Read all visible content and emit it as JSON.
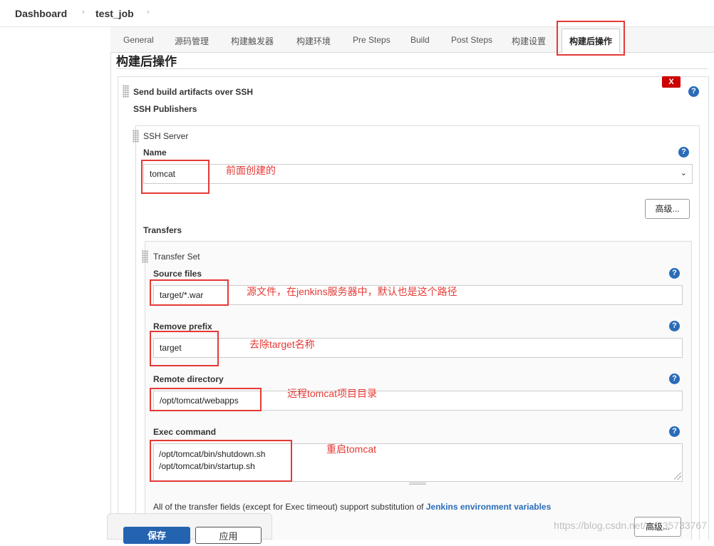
{
  "breadcrumb": {
    "dashboard": "Dashboard",
    "job": "test_job",
    "separator": "›"
  },
  "tabs": [
    "General",
    "源码管理",
    "构建触发器",
    "构建环境",
    "Pre Steps",
    "Build",
    "Post Steps",
    "构建设置",
    "构建后操作"
  ],
  "section": {
    "title": "构建后操作"
  },
  "publisher": {
    "title": "Send build artifacts over SSH",
    "close_label": "X",
    "ssh_publishers_label": "SSH Publishers",
    "ssh_server_label": "SSH Server",
    "name_label": "Name",
    "name_value": "tomcat",
    "advanced_label": "高级...",
    "transfers_label": "Transfers",
    "transfer_set_label": "Transfer Set",
    "source_files_label": "Source files",
    "source_files_value": "target/*.war",
    "remove_prefix_label": "Remove prefix",
    "remove_prefix_value": "target",
    "remote_directory_label": "Remote directory",
    "remote_directory_value": "/opt/tomcat/webapps",
    "exec_command_label": "Exec command",
    "exec_command_line1": "/opt/tomcat/bin/shutdown.sh",
    "exec_command_line2": "/opt/tomcat/bin/startup.sh",
    "note_text": "All of the transfer fields (except for Exec timeout) support substitution of ",
    "note_link": "Jenkins environment variables",
    "advanced2_label": "高级..."
  },
  "annotations": {
    "name": "前面创建的",
    "source_files": "源文件，在jenkins服务器中，默认也是这个路径",
    "remove_prefix": "去除target名称",
    "remote_directory": "远程tomcat项目目录",
    "exec_command": "重启tomcat"
  },
  "help_icon": "?",
  "footer": {
    "save_label": "保存",
    "apply_label": "应用"
  },
  "watermark": "https://blog.csdn.net/qq_35733767",
  "colors": {
    "annotation": "#e53935",
    "link": "#2a6cb8",
    "save": "#2463b0",
    "close": "#cc0000"
  }
}
